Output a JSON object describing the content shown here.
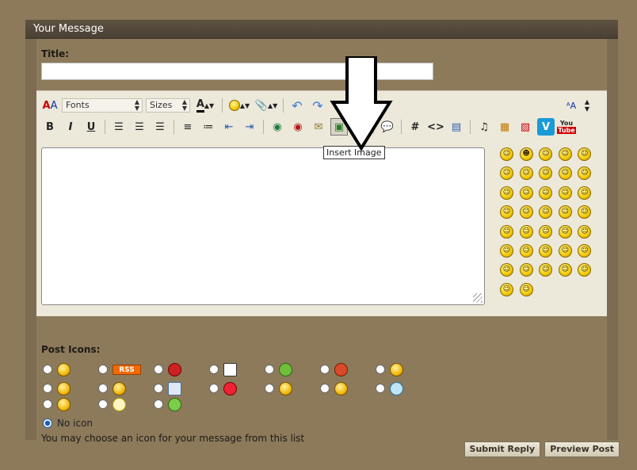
{
  "panel": {
    "heading": "Your Message"
  },
  "title_field": {
    "label": "Title:",
    "value": ""
  },
  "toolbar": {
    "font_select": "Fonts",
    "size_select": "Sizes",
    "row1_icons": [
      "remove-format-icon",
      "font-color-icon",
      "smiley-icon",
      "attachment-icon",
      "undo-icon",
      "redo-icon",
      "switch-mode-icon",
      "resize-icon"
    ],
    "row2": {
      "bold": "B",
      "italic": "I",
      "underline": "U",
      "hash": "#",
      "code": "<>"
    },
    "insert_image_tooltip": "Insert Image"
  },
  "message": {
    "value": ""
  },
  "smilies": [
    "☺",
    "☻",
    "☺",
    "☺",
    "☺",
    "☺",
    "☺",
    "☺",
    "☺",
    "☺",
    "☺",
    "☺",
    "☺",
    "☺",
    "☺",
    "☺",
    "☺",
    "☺",
    "☺",
    "☺",
    "☺",
    "☺",
    "☺",
    "☺",
    "☺",
    "☺",
    "☺",
    "☺",
    "☺",
    "☺",
    "☺",
    "☺",
    "☺",
    "☺",
    "☺",
    "☺",
    "☺"
  ],
  "post_icons": {
    "label": "Post Icons:",
    "rss_text": "RSS",
    "no_icon_label": "No icon",
    "hint": "You may choose an icon for your message from this list"
  },
  "buttons": {
    "submit": "Submit Reply",
    "preview": "Preview Post"
  },
  "colors": {
    "panel_bg": "#7d6c52",
    "editor_bg": "#ece8da",
    "header_bg": "#4a4034"
  }
}
